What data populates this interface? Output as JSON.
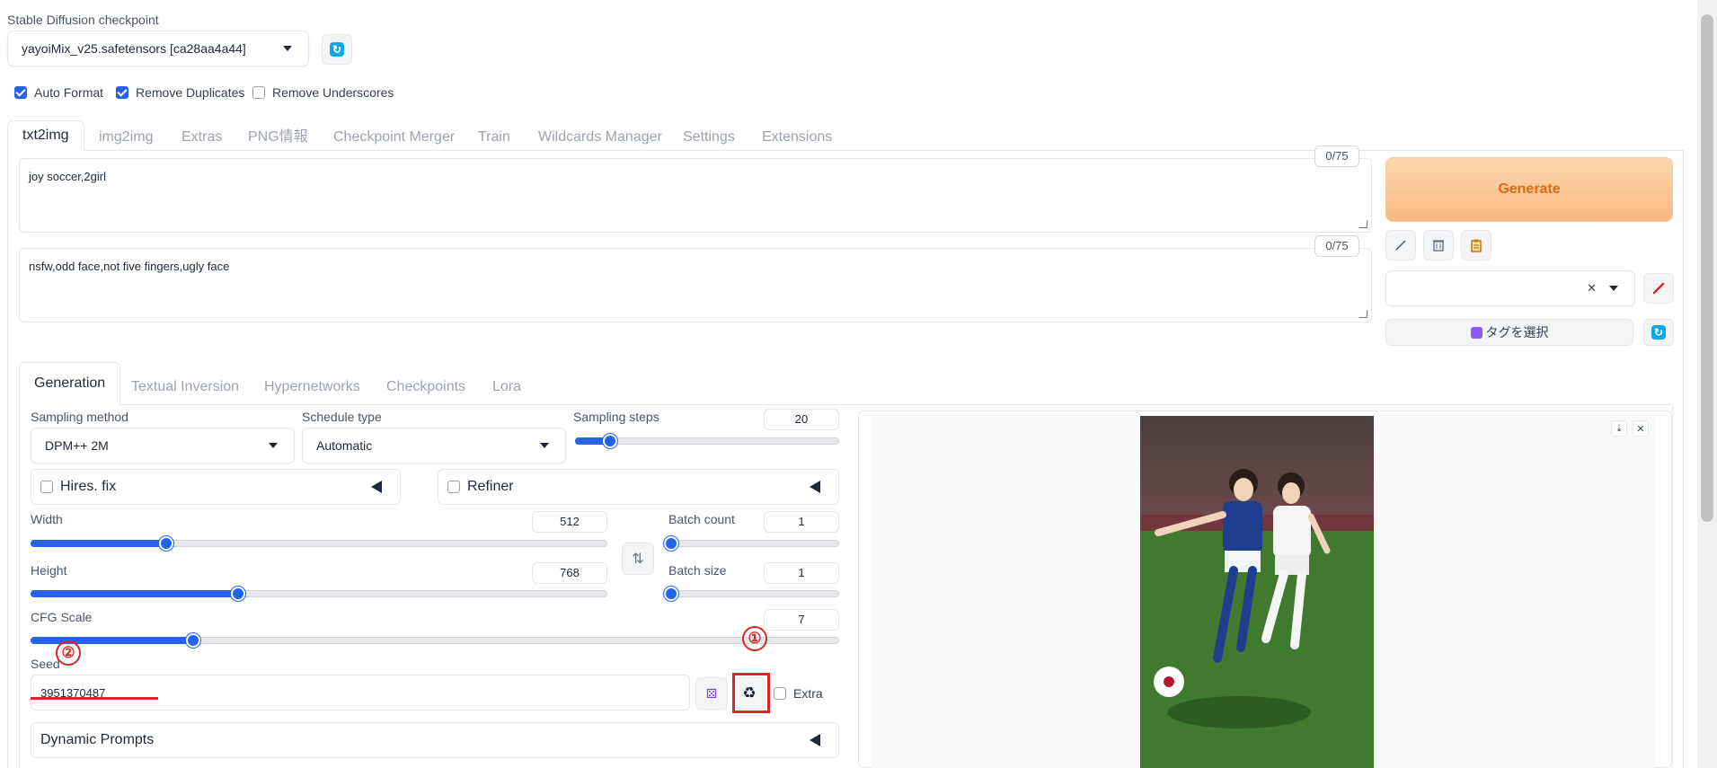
{
  "checkpoint": {
    "label": "Stable Diffusion checkpoint",
    "value": "yayoiMix_v25.safetensors [ca28aa4a44]"
  },
  "options": {
    "auto_format": {
      "label": "Auto Format",
      "checked": true
    },
    "remove_duplicates": {
      "label": "Remove Duplicates",
      "checked": true
    },
    "remove_underscores": {
      "label": "Remove Underscores",
      "checked": false
    }
  },
  "tabs": [
    {
      "label": "txt2img",
      "active": true
    },
    {
      "label": "img2img"
    },
    {
      "label": "Extras"
    },
    {
      "label": "PNG情報"
    },
    {
      "label": "Checkpoint Merger"
    },
    {
      "label": "Train"
    },
    {
      "label": "Wildcards Manager"
    },
    {
      "label": "Settings"
    },
    {
      "label": "Extensions"
    }
  ],
  "prompt": {
    "value": "joy soccer,2girl",
    "counter": "0/75"
  },
  "negative_prompt": {
    "value": "nsfw,odd face,not five fingers,ugly face",
    "counter": "0/75"
  },
  "generate_label": "Generate",
  "tag_select_label": "タグを選択",
  "subtabs": [
    {
      "label": "Generation",
      "active": true
    },
    {
      "label": "Textual Inversion"
    },
    {
      "label": "Hypernetworks"
    },
    {
      "label": "Checkpoints"
    },
    {
      "label": "Lora"
    }
  ],
  "sampling_method": {
    "label": "Sampling method",
    "value": "DPM++ 2M"
  },
  "schedule_type": {
    "label": "Schedule type",
    "value": "Automatic"
  },
  "sampling_steps": {
    "label": "Sampling steps",
    "value": "20",
    "fraction": 0.13
  },
  "hires_fix": {
    "label": "Hires. fix"
  },
  "refiner": {
    "label": "Refiner"
  },
  "width": {
    "label": "Width",
    "value": "512",
    "fraction": 0.235
  },
  "height": {
    "label": "Height",
    "value": "768",
    "fraction": 0.36
  },
  "batch_count": {
    "label": "Batch count",
    "value": "1",
    "fraction": 0.0
  },
  "batch_size": {
    "label": "Batch size",
    "value": "1",
    "fraction": 0.0
  },
  "cfg_scale": {
    "label": "CFG Scale",
    "value": "7",
    "fraction": 0.2
  },
  "seed": {
    "label": "Seed",
    "value": "3951370487"
  },
  "extra_label": "Extra",
  "dynamic_prompts_label": "Dynamic Prompts",
  "annotations": {
    "one": "①",
    "two": "②"
  },
  "colors": {
    "accent": "#2563eb",
    "generate": "#f9b982",
    "annotation": "#dc2626"
  }
}
